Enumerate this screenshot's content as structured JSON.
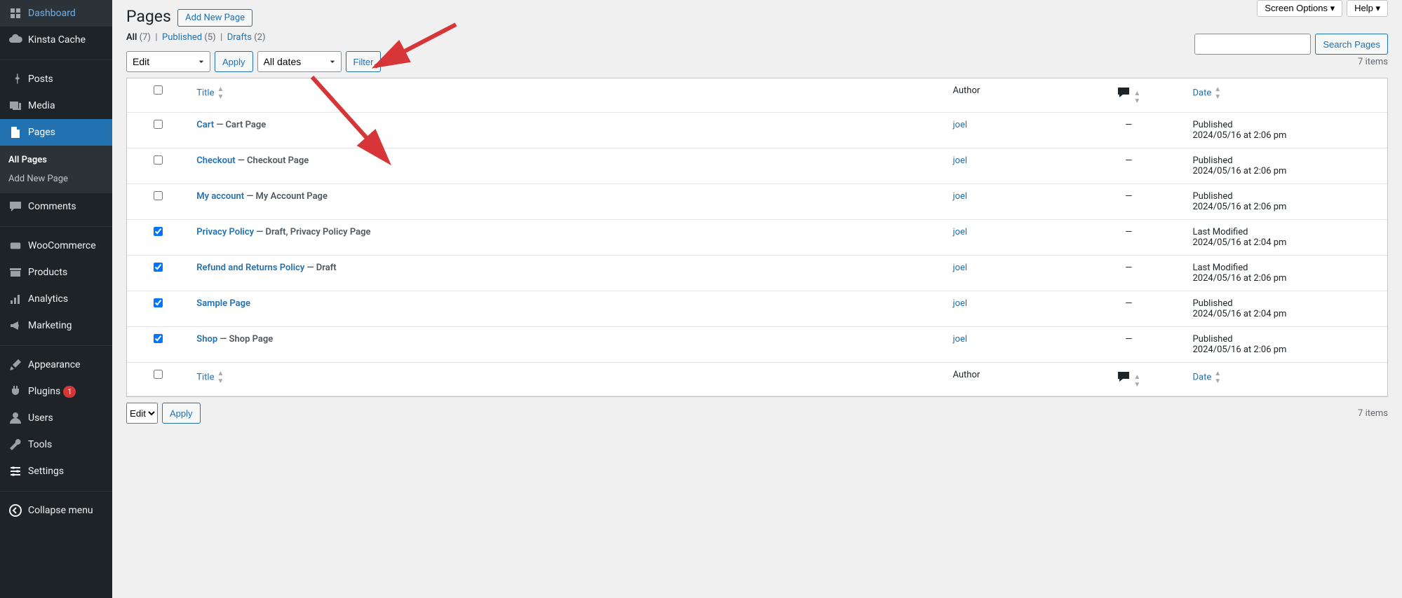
{
  "sidebar": {
    "items": [
      {
        "label": "Dashboard",
        "icon": "dashboard"
      },
      {
        "label": "Kinsta Cache",
        "icon": "cloud"
      },
      {
        "label": "Posts",
        "icon": "pin"
      },
      {
        "label": "Media",
        "icon": "media"
      },
      {
        "label": "Pages",
        "icon": "page"
      },
      {
        "label": "Comments",
        "icon": "chat"
      },
      {
        "label": "WooCommerce",
        "icon": "woo"
      },
      {
        "label": "Products",
        "icon": "archive"
      },
      {
        "label": "Analytics",
        "icon": "bars"
      },
      {
        "label": "Marketing",
        "icon": "megaphone"
      },
      {
        "label": "Appearance",
        "icon": "brush"
      },
      {
        "label": "Plugins",
        "icon": "plug",
        "badge": "1"
      },
      {
        "label": "Users",
        "icon": "user"
      },
      {
        "label": "Tools",
        "icon": "wrench"
      },
      {
        "label": "Settings",
        "icon": "sliders"
      },
      {
        "label": "Collapse menu",
        "icon": "collapse"
      }
    ],
    "submenu": [
      "All Pages",
      "Add New Page"
    ]
  },
  "topright": {
    "screen_options": "Screen Options",
    "help": "Help"
  },
  "header": {
    "title": "Pages",
    "add_new": "Add New Page"
  },
  "filters": {
    "all": "All",
    "all_count": "(7)",
    "published": "Published",
    "published_count": "(5)",
    "drafts": "Drafts",
    "drafts_count": "(2)"
  },
  "bulk": {
    "action": "Edit",
    "apply": "Apply",
    "dates": "All dates",
    "filter": "Filter"
  },
  "search": {
    "button": "Search Pages"
  },
  "items_count": "7 items",
  "columns": {
    "title": "Title",
    "author": "Author",
    "date": "Date"
  },
  "rows": [
    {
      "checked": false,
      "title": "Cart",
      "suffix": " — Cart Page",
      "author": "joel",
      "comments": "—",
      "status": "Published",
      "date": "2024/05/16 at 2:06 pm"
    },
    {
      "checked": false,
      "title": "Checkout",
      "suffix": " — Checkout Page",
      "author": "joel",
      "comments": "—",
      "status": "Published",
      "date": "2024/05/16 at 2:06 pm"
    },
    {
      "checked": false,
      "title": "My account",
      "suffix": " — My Account Page",
      "author": "joel",
      "comments": "—",
      "status": "Published",
      "date": "2024/05/16 at 2:06 pm"
    },
    {
      "checked": true,
      "title": "Privacy Policy",
      "suffix": " — Draft, Privacy Policy Page",
      "author": "joel",
      "comments": "—",
      "status": "Last Modified",
      "date": "2024/05/16 at 2:04 pm"
    },
    {
      "checked": true,
      "title": "Refund and Returns Policy",
      "suffix": " — Draft",
      "author": "joel",
      "comments": "—",
      "status": "Last Modified",
      "date": "2024/05/16 at 2:06 pm"
    },
    {
      "checked": true,
      "title": "Sample Page",
      "suffix": "",
      "author": "joel",
      "comments": "—",
      "status": "Published",
      "date": "2024/05/16 at 2:04 pm"
    },
    {
      "checked": true,
      "title": "Shop",
      "suffix": " — Shop Page",
      "author": "joel",
      "comments": "—",
      "status": "Published",
      "date": "2024/05/16 at 2:06 pm"
    }
  ]
}
